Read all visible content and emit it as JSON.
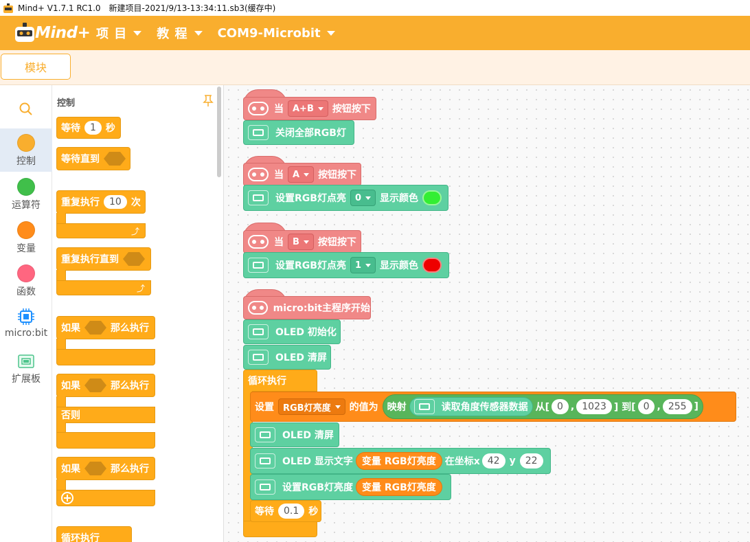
{
  "window": {
    "app_name": "Mind+ V1.7.1 RC1.0",
    "file_title": "新建项目-2021/9/13-13:34:11.sb3(缓存中)"
  },
  "menubar": {
    "logo_text": "Mind+",
    "menu_project": "项 目",
    "menu_tutorial": "教 程",
    "menu_device": "COM9-Microbit"
  },
  "tabs": {
    "modules": "模块"
  },
  "categories": [
    {
      "label": "控制",
      "color": "#f9ae2e"
    },
    {
      "label": "运算符",
      "color": "#40bf4a"
    },
    {
      "label": "变量",
      "color": "#ff8c1a"
    },
    {
      "label": "函数",
      "color": "#ff6680"
    },
    {
      "label": "micro:bit",
      "icon": "microbit-chip-icon"
    },
    {
      "label": "扩展板",
      "icon": "extension-board-icon"
    }
  ],
  "palette": {
    "header": "控制",
    "wait_label": "等待",
    "wait_value": "1",
    "wait_unit": "秒",
    "wait_until": "等待直到",
    "repeat_label": "重复执行",
    "repeat_value": "10",
    "repeat_unit": "次",
    "repeat_until": "重复执行直到",
    "if_label": "如果",
    "then_label": "那么执行",
    "else_label": "否则",
    "forever_label": "循环执行"
  },
  "script": {
    "hat1": {
      "when": "当",
      "button": "A+B",
      "pressed": "按钮按下"
    },
    "clear_rgb": "关闭全部RGB灯",
    "hat2": {
      "when": "当",
      "button": "A",
      "pressed": "按钮按下"
    },
    "set_rgb1": {
      "label": "设置RGB灯点亮",
      "index": "0",
      "show_color": "显示颜色",
      "color": "#33ee33"
    },
    "hat3": {
      "when": "当",
      "button": "B",
      "pressed": "按钮按下"
    },
    "set_rgb2": {
      "label": "设置RGB灯点亮",
      "index": "1",
      "show_color": "显示颜色",
      "color": "#ee0000"
    },
    "main_start": "micro:bit主程序开始",
    "oled_init": "OLED 初始化",
    "oled_clear": "OLED 清屏",
    "loop": "循环执行",
    "set_var": {
      "set": "设置",
      "var": "RGB灯亮度",
      "value_is": "的值为",
      "map": "映射",
      "read": "读取角度传感器数据",
      "from": "从[",
      "from_lo": "0",
      "comma": ",",
      "from_hi": "1023",
      "to": "] 到[",
      "to_lo": "0",
      "to_hi": "255",
      "close": "]"
    },
    "oled_clear2": "OLED 清屏",
    "oled_text": {
      "label": "OLED 显示文字",
      "var": "变量 RGB灯亮度",
      "at": "在坐标x",
      "x": "42",
      "y_label": "y",
      "y": "22"
    },
    "set_brightness": {
      "label": "设置RGB灯亮度",
      "var": "变量 RGB灯亮度"
    },
    "wait": {
      "label": "等待",
      "value": "0.1",
      "unit": "秒"
    }
  }
}
